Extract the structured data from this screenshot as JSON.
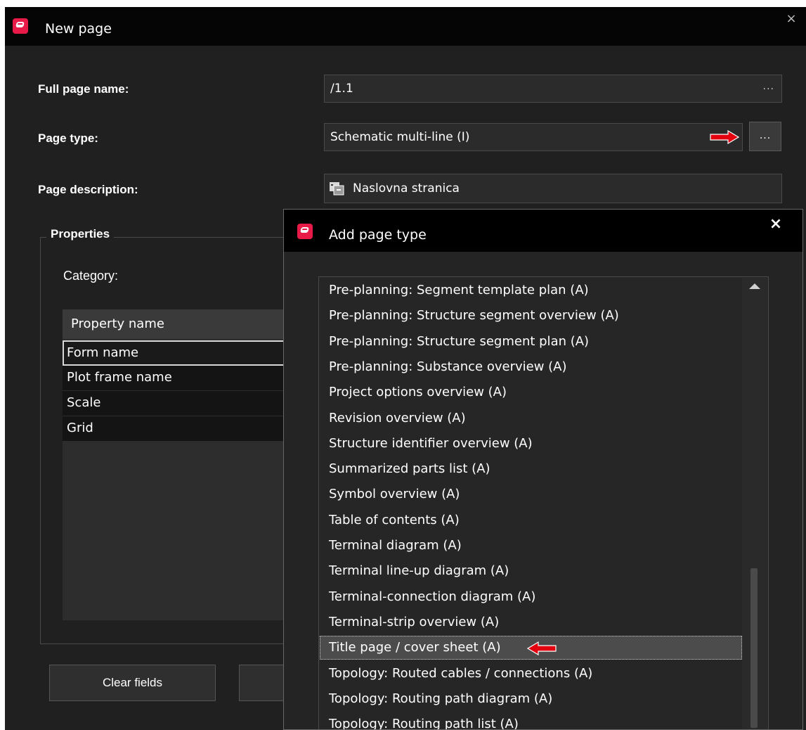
{
  "main_dialog": {
    "title": "New page",
    "close_glyph": "×",
    "fields": {
      "full_page_name": {
        "label": "Full page name:",
        "value": "/1.1",
        "ellipsis": "..."
      },
      "page_type": {
        "label": "Page type:",
        "value": "Schematic multi-line (I)",
        "ellipsis": "..."
      },
      "page_description": {
        "label": "Page description:",
        "value": "Naslovna stranica"
      }
    },
    "properties": {
      "legend": "Properties",
      "category_label": "Category:",
      "grid": {
        "header": "Property name",
        "rows": [
          "Form name",
          "Plot frame name",
          "Scale",
          "Grid"
        ],
        "selected_index": 0
      }
    },
    "buttons": {
      "clear_fields": "Clear fields"
    }
  },
  "popup": {
    "title": "Add page type",
    "close_glyph": "×",
    "items": [
      "Pre-planning: Segment template plan (A)",
      "Pre-planning: Structure segment overview (A)",
      "Pre-planning: Structure segment plan (A)",
      "Pre-planning: Substance overview (A)",
      "Project options overview (A)",
      "Revision overview (A)",
      "Structure identifier overview (A)",
      "Summarized parts list (A)",
      "Symbol overview (A)",
      "Table of contents (A)",
      "Terminal diagram (A)",
      "Terminal line-up diagram (A)",
      "Terminal-connection diagram (A)",
      "Terminal-strip overview (A)",
      "Title page / cover sheet (A)",
      "Topology: Routed cables / connections (A)",
      "Topology: Routing path diagram (A)",
      "Topology: Routing path list (A)"
    ],
    "selected_index": 14
  },
  "icons": {
    "app": "eplan-app-icon",
    "description_lang": "translate-icon",
    "annotation": "red-arrow-icon"
  },
  "colors": {
    "accent": "#e81b48",
    "arrow": "#e3000f",
    "background": "#202020"
  }
}
